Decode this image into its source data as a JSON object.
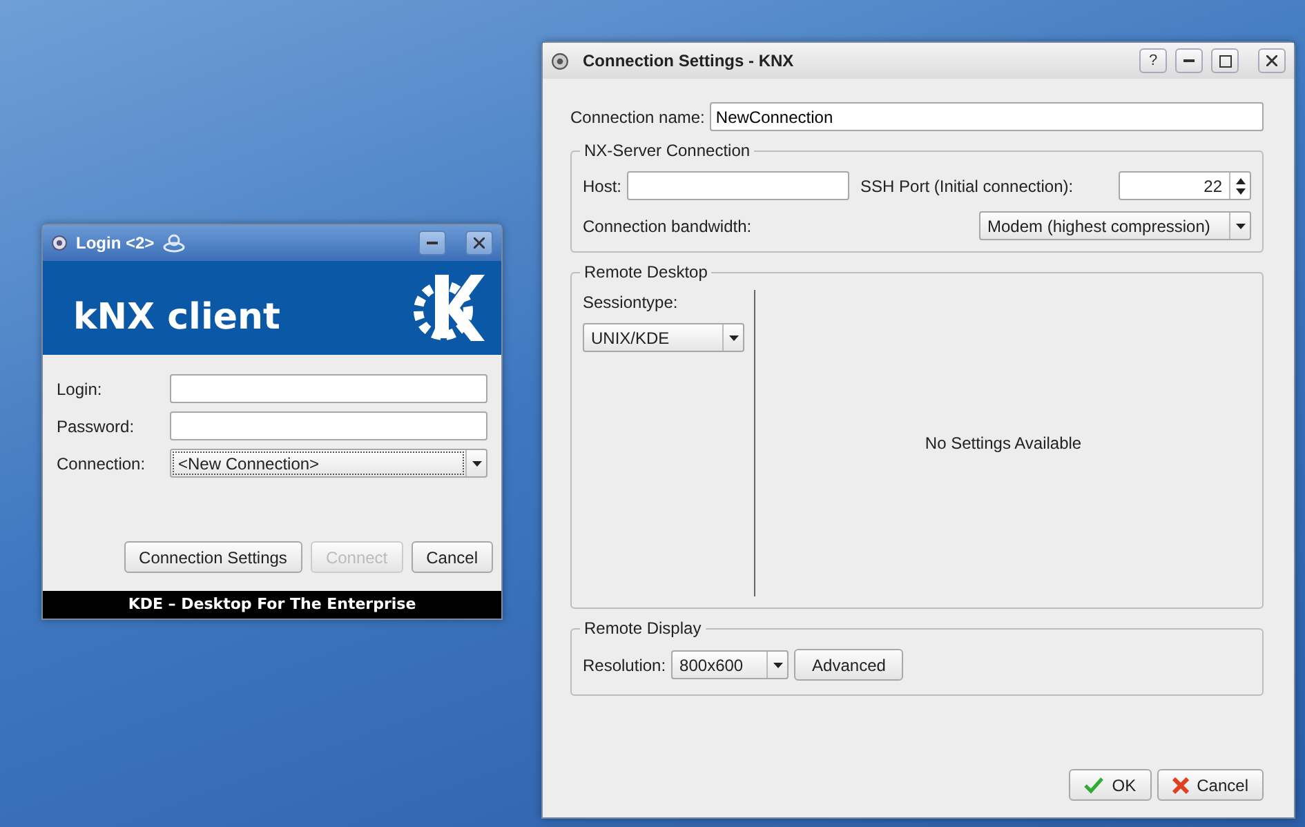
{
  "login_window": {
    "title": "Login <2>",
    "banner": {
      "title": "kNX client"
    },
    "fields": [
      {
        "label": "Login:",
        "kind": "text"
      },
      {
        "label": "Password:",
        "kind": "text"
      },
      {
        "label": "Connection:",
        "kind": "combo",
        "value": "<New Connection>"
      }
    ],
    "buttons": [
      {
        "label": "Connection Settings",
        "disabled": false
      },
      {
        "label": "Connect",
        "disabled": true
      },
      {
        "label": "Cancel",
        "disabled": false
      }
    ],
    "footer": "KDE – Desktop For The Enterprise"
  },
  "settings_window": {
    "title": "Connection Settings - KNX",
    "title_buttons": [
      "?"
    ],
    "connection_name": {
      "label": "Connection name:",
      "value": "NewConnection"
    },
    "nx_server": {
      "title": "NX-Server Connection",
      "host_label": "Host:",
      "port_label": "SSH Port (Initial connection):",
      "port_value": "22",
      "bandwidth_label": "Connection bandwidth:",
      "bandwidth_value": "Modem (highest compression)"
    },
    "remote_desktop": {
      "title": "Remote Desktop",
      "sessiontype_label": "Sessiontype:",
      "sessiontype_value": "UNIX/KDE",
      "message": "No Settings Available"
    },
    "remote_display": {
      "title": "Remote Display",
      "resolution_label": "Resolution:",
      "resolution_value": "800x600",
      "advanced_button": "Advanced"
    },
    "buttons": [
      {
        "label": "OK",
        "kind": "ok"
      },
      {
        "label": "Cancel",
        "kind": "cancel"
      }
    ]
  }
}
